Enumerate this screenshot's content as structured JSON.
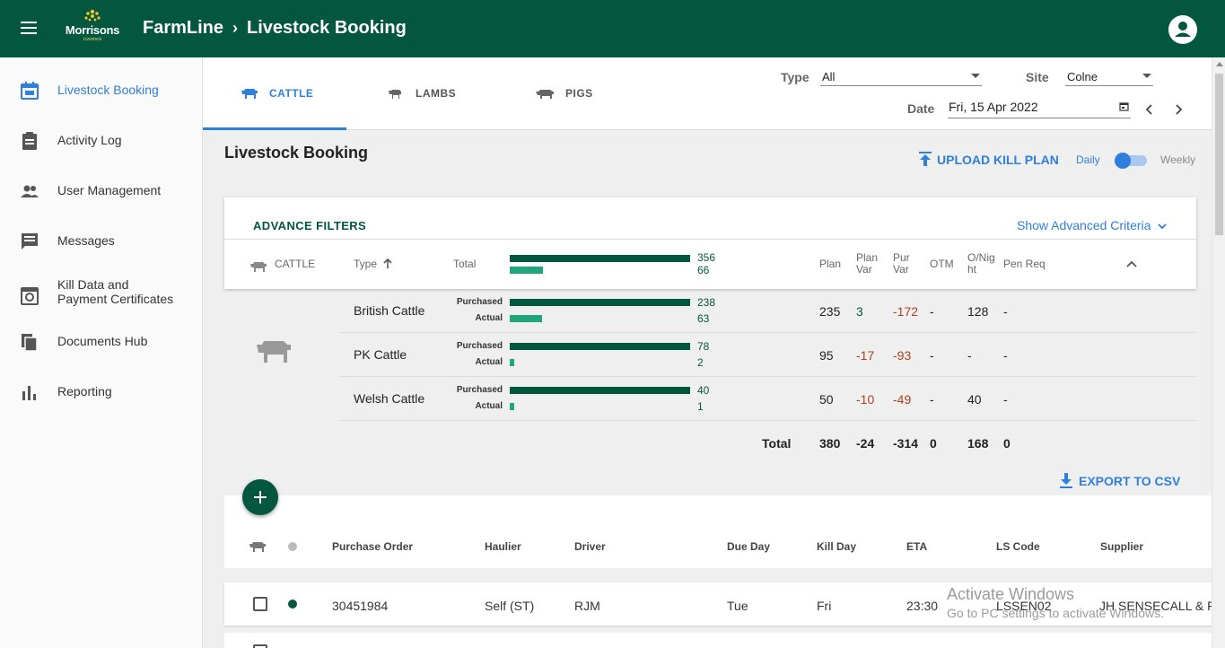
{
  "header": {
    "logo_brand": "Morrisons",
    "logo_tagline": "Livestock",
    "app_title": "FarmLine",
    "page": "Livestock Booking",
    "menu_icon": "menu-icon",
    "avatar_icon": "account-icon"
  },
  "sidebar": {
    "items": [
      {
        "label": "Livestock Booking",
        "icon": "booking-calendar-icon",
        "active": true
      },
      {
        "label": "Activity Log",
        "icon": "clipboard-icon"
      },
      {
        "label": "User Management",
        "icon": "users-icon"
      },
      {
        "label": "Messages",
        "icon": "message-icon"
      },
      {
        "label": "Kill Data and Payment Certificates",
        "label_line1": "Kill Data and",
        "label_line2": "Payment Certificates",
        "icon": "certificate-icon"
      },
      {
        "label": "Documents Hub",
        "icon": "documents-icon"
      },
      {
        "label": "Reporting",
        "icon": "bar-chart-icon"
      }
    ]
  },
  "tabs": [
    {
      "label": "CATTLE",
      "icon": "cattle-icon",
      "active": true
    },
    {
      "label": "LAMBS",
      "icon": "lamb-icon"
    },
    {
      "label": "PIGS",
      "icon": "pig-icon"
    }
  ],
  "filters_bar": {
    "type_label": "Type",
    "type_value": "All",
    "site_label": "Site",
    "site_value": "Colne",
    "date_label": "Date",
    "date_value": "Fri, 15 Apr 2022"
  },
  "main": {
    "title": "Livestock Booking",
    "upload_label": "UPLOAD KILL PLAN",
    "toggle_daily": "Daily",
    "toggle_weekly": "Weekly",
    "export_label": "EXPORT TO CSV"
  },
  "advance_filters": {
    "title": "ADVANCE FILTERS",
    "show_link": "Show Advanced Criteria",
    "headers": {
      "species": "CATTLE",
      "type": "Type",
      "total": "Total",
      "plan": "Plan",
      "plan_var_1": "Plan",
      "plan_var_2": "Var",
      "pur_var_1": "Pur",
      "pur_var_2": "Var",
      "otm": "OTM",
      "onight_1": "O/Nig",
      "onight_2": "ht",
      "pen_req": "Pen Req"
    },
    "total_purchased": 356,
    "total_actual": 66,
    "purchased_label": "Purchased",
    "actual_label": "Actual",
    "rows": [
      {
        "name": "British Cattle",
        "purchased": 238,
        "actual": 63,
        "plan": "235",
        "plan_var": "3",
        "pur_var": "-172",
        "otm": "-",
        "onight": "128",
        "pen_req": "-"
      },
      {
        "name": "PK Cattle",
        "purchased": 78,
        "actual": 2,
        "plan": "95",
        "plan_var": "-17",
        "pur_var": "-93",
        "otm": "-",
        "onight": "-",
        "pen_req": "-"
      },
      {
        "name": "Welsh Cattle",
        "purchased": 40,
        "actual": 1,
        "plan": "50",
        "plan_var": "-10",
        "pur_var": "-49",
        "otm": "-",
        "onight": "40",
        "pen_req": "-"
      }
    ],
    "totals": {
      "label": "Total",
      "plan": "380",
      "plan_var": "-24",
      "pur_var": "-314",
      "otm": "0",
      "onight": "168",
      "pen_req": "0"
    }
  },
  "orders_table": {
    "headers": [
      "Purchase Order",
      "Haulier",
      "Driver",
      "Due Day",
      "Kill Day",
      "ETA",
      "LS Code",
      "Supplier"
    ],
    "rows": [
      {
        "purchase_order": "30451984",
        "haulier": "Self (ST)",
        "driver": "RJM",
        "due_day": "Tue",
        "kill_day": "Fri",
        "eta": "23:30",
        "ls_code": "LSSEN02",
        "supplier": "JH SENSECALL & F"
      }
    ]
  },
  "watermark": {
    "line1": "Activate Windows",
    "line2": "Go to PC settings to activate Windows."
  },
  "colors": {
    "brand_green": "#03573f",
    "accent_blue": "#2f7fdc",
    "bar_dark": "#03573f",
    "bar_light": "#1fa67a",
    "negative": "#b04020"
  }
}
